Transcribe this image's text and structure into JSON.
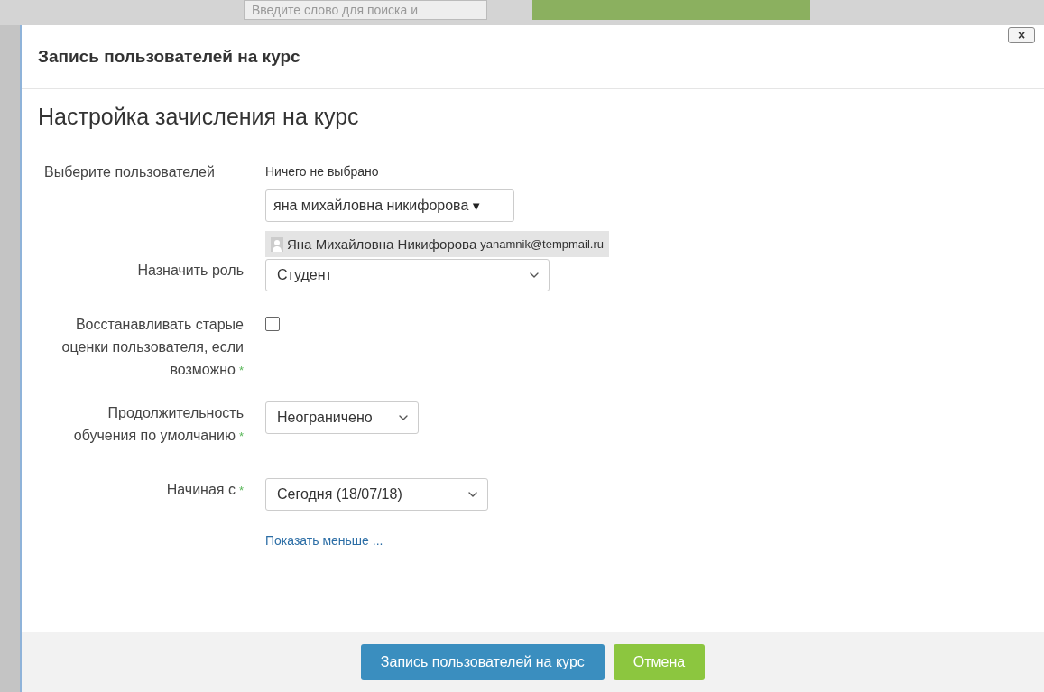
{
  "background": {
    "search_placeholder": "Введите слово для поиска и"
  },
  "dialog": {
    "title": "Запись пользователей на курс",
    "close": "×"
  },
  "form": {
    "heading": "Настройка зачисления на курс",
    "required_mark": "*",
    "fields": [
      {
        "kind": "user-picker",
        "label": "Выберите пользователей",
        "selection_text": "Ничего не выбрано",
        "search_value": "яна михайловна никифорова",
        "arrow": "▼",
        "suggestions": [
          {
            "name": "Яна Михайловна Никифорова",
            "email": "yanamnik@tempmail.ru"
          }
        ]
      },
      {
        "kind": "select",
        "label": "Назначить роль",
        "value": "Студент",
        "required": false
      },
      {
        "kind": "checkbox",
        "label": "Восстанавливать старые оценки пользователя, если возможно",
        "checked": false,
        "required": true
      },
      {
        "kind": "select",
        "label": "Продолжительность обучения по умолчанию",
        "value": "Неограничено",
        "required": true
      },
      {
        "kind": "select",
        "label": "Начиная с",
        "value": "Сегодня (18/07/18)",
        "required": true
      }
    ],
    "toggle_link": "Показать меньше ..."
  },
  "buttons": [
    {
      "label": "Запись пользователей на курс",
      "kind": "primary"
    },
    {
      "label": "Отмена",
      "kind": "cancel"
    }
  ]
}
